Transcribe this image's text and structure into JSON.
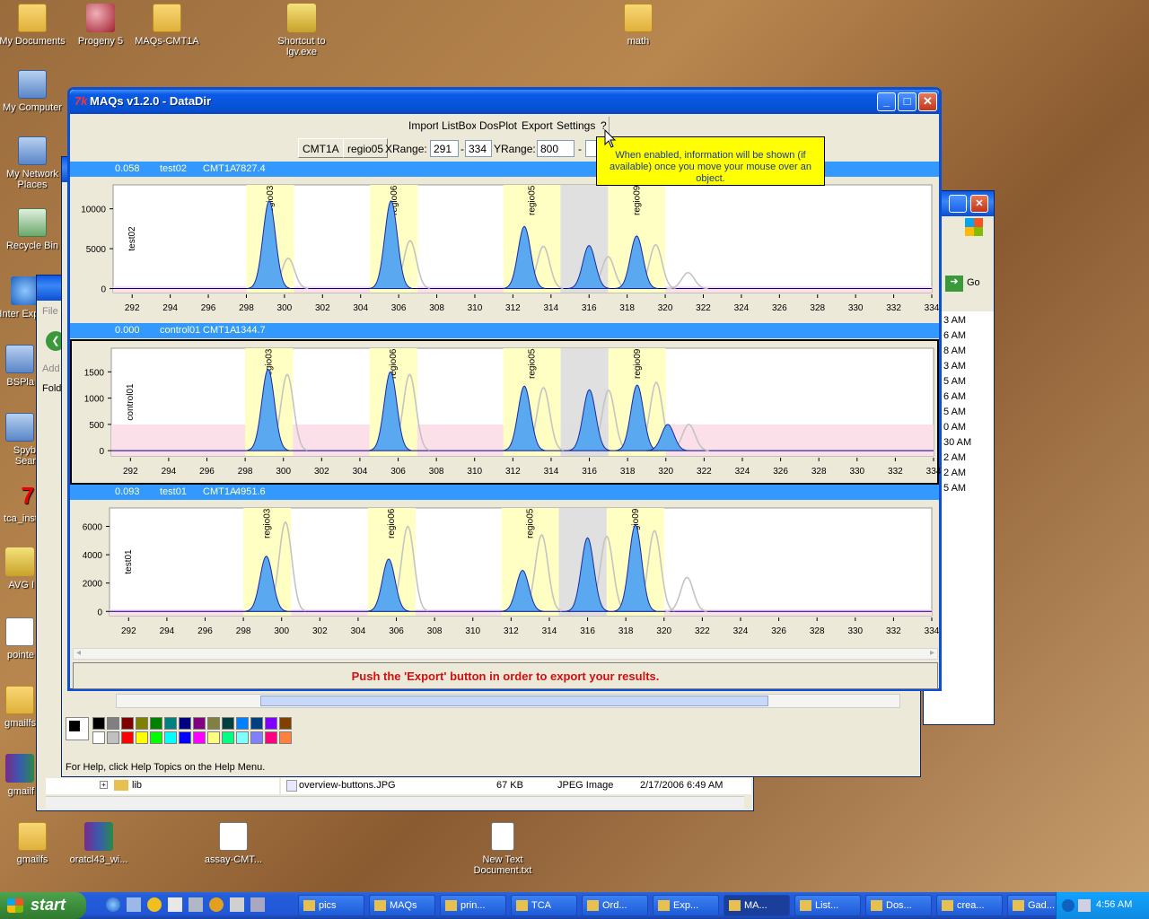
{
  "desktop_icons": [
    {
      "label": "My Documents",
      "icon": "folder-docs-icon"
    },
    {
      "label": "Progeny 5",
      "icon": "progeny-icon"
    },
    {
      "label": "MAQs-CMT1A",
      "icon": "folder-icon"
    },
    {
      "label": "Shortcut to lgv.exe",
      "icon": "lamp-icon"
    },
    {
      "label": "math",
      "icon": "folder-icon"
    },
    {
      "label": "My Computer",
      "icon": "computer-icon"
    },
    {
      "label": "My Network Places",
      "icon": "network-icon"
    },
    {
      "label": "Recycle Bin",
      "icon": "recycle-bin-icon"
    },
    {
      "label": "Inter Explo",
      "icon": "ie-icon"
    },
    {
      "label": "BSPla",
      "icon": "bsplayer-icon"
    },
    {
      "label": "Spyb Sear",
      "icon": "spybot-icon"
    },
    {
      "label": "tca_inst",
      "icon": "tk-icon"
    },
    {
      "label": "AVG I",
      "icon": "avg-icon"
    },
    {
      "label": "pointe",
      "icon": "pointer-icon"
    },
    {
      "label": "gmailfs",
      "icon": "folder-icon"
    },
    {
      "label": "gmailf",
      "icon": "rar-icon"
    },
    {
      "label": "gmailfs",
      "icon": "folder-icon"
    },
    {
      "label": "oratcl43_wi...",
      "icon": "rar-icon"
    },
    {
      "label": "assay-CMT...",
      "icon": "image-icon"
    },
    {
      "label": "New Text Document.txt",
      "icon": "text-file-icon"
    }
  ],
  "background_windows": {
    "paint": {
      "status": "For Help, click Help Topics on the Help Menu."
    },
    "explorer": {
      "menu": "File",
      "address": "Add",
      "folders": "Fold",
      "tree_item": "lib",
      "file_row": {
        "name": "overview-buttons.JPG",
        "size": "67 KB",
        "type": "JPEG Image",
        "date": "2/17/2006 6:49 AM"
      }
    },
    "right_window": {
      "go_label": "Go",
      "times": [
        "3 AM",
        "6 AM",
        "8 AM",
        "3 AM",
        "5 AM",
        "6 AM",
        "5 AM",
        "0 AM",
        "30 AM",
        "2 AM",
        "2 AM",
        "5 AM"
      ]
    }
  },
  "main_window": {
    "title": "MAQs v1.2.0 - DataDir",
    "title_icon": "tk-feather-icon",
    "toolbar": [
      "Import",
      "ListBox",
      "DosPlot",
      "Export",
      "Settings",
      "?"
    ],
    "controls": {
      "gene_button": "CMT1A",
      "region_button": "regio05",
      "xrange_label": "XRange:",
      "xrange_min": "291",
      "xrange_sep": "-",
      "xrange_max": "334",
      "yrange_label": "YRange:",
      "yrange_min": "800",
      "yrange_sep": "-"
    },
    "tooltip": "When enabled, information will be shown (if available) once you move your mouse over an object.",
    "status_message": "Push the 'Export' button in order to export your results.",
    "accent": "#3399ff"
  },
  "chart_data": [
    {
      "type": "line",
      "header": {
        "score": "0.058",
        "sample": "test02",
        "gene": "CMT1A",
        "value": "7827.4"
      },
      "ylabel": "test02",
      "xlim": [
        291,
        334
      ],
      "x_ticks": [
        292,
        294,
        296,
        298,
        300,
        302,
        304,
        306,
        308,
        310,
        312,
        314,
        316,
        318,
        320,
        322,
        324,
        326,
        328,
        330,
        332,
        334
      ],
      "y_ticks": [
        0,
        5000,
        10000
      ],
      "ylim": [
        -500,
        13000
      ],
      "regions": [
        {
          "name": "regio03",
          "x": [
            298.0,
            300.5
          ]
        },
        {
          "name": "regio06",
          "x": [
            304.5,
            307.0
          ]
        },
        {
          "name": "regio05",
          "x": [
            311.5,
            314.5
          ]
        },
        {
          "name": "",
          "x": [
            314.5,
            317.0
          ],
          "grey": true
        },
        {
          "name": "regio09",
          "x": [
            317.0,
            320.0
          ]
        }
      ],
      "peaks_sample": [
        {
          "x": 299.2,
          "y": 11000
        },
        {
          "x": 305.6,
          "y": 11000
        },
        {
          "x": 312.6,
          "y": 7800
        },
        {
          "x": 316.0,
          "y": 5400
        },
        {
          "x": 318.5,
          "y": 6600
        }
      ],
      "peaks_reference": [
        {
          "x": 300.2,
          "y": 3800
        },
        {
          "x": 306.6,
          "y": 6000
        },
        {
          "x": 313.6,
          "y": 5300
        },
        {
          "x": 317.0,
          "y": 4000
        },
        {
          "x": 319.5,
          "y": 5500
        },
        {
          "x": 321.2,
          "y": 2000
        }
      ]
    },
    {
      "type": "line",
      "header": {
        "score": "0.000",
        "sample": "control01",
        "gene": "CMT1A",
        "value": "1344.7"
      },
      "ylabel": "control01",
      "xlim": [
        291,
        334
      ],
      "x_ticks": [
        292,
        294,
        296,
        298,
        300,
        302,
        304,
        306,
        308,
        310,
        312,
        314,
        316,
        318,
        320,
        322,
        324,
        326,
        328,
        330,
        332,
        334
      ],
      "y_ticks": [
        0,
        500,
        1000,
        1500
      ],
      "ylim": [
        -100,
        1950
      ],
      "regions": [
        {
          "name": "regio03",
          "x": [
            298.0,
            300.5
          ]
        },
        {
          "name": "regio06",
          "x": [
            304.5,
            307.0
          ]
        },
        {
          "name": "regio05",
          "x": [
            311.5,
            314.5
          ]
        },
        {
          "name": "",
          "x": [
            314.5,
            317.0
          ],
          "grey": true
        },
        {
          "name": "regio09",
          "x": [
            317.0,
            320.0
          ]
        }
      ],
      "peaks_sample": [
        {
          "x": 299.2,
          "y": 1550
        },
        {
          "x": 305.6,
          "y": 1500
        },
        {
          "x": 312.6,
          "y": 1230
        },
        {
          "x": 316.0,
          "y": 1160
        },
        {
          "x": 318.5,
          "y": 1250
        },
        {
          "x": 320.1,
          "y": 500
        }
      ],
      "peaks_reference": [
        {
          "x": 300.2,
          "y": 1450
        },
        {
          "x": 306.6,
          "y": 1450
        },
        {
          "x": 313.6,
          "y": 1200
        },
        {
          "x": 317.0,
          "y": 1150
        },
        {
          "x": 319.5,
          "y": 1300
        },
        {
          "x": 321.2,
          "y": 500
        }
      ]
    },
    {
      "type": "line",
      "header": {
        "score": "0.093",
        "sample": "test01",
        "gene": "CMT1A",
        "value": "4951.6"
      },
      "ylabel": "test01",
      "xlim": [
        291,
        334
      ],
      "x_ticks": [
        292,
        294,
        296,
        298,
        300,
        302,
        304,
        306,
        308,
        310,
        312,
        314,
        316,
        318,
        320,
        322,
        324,
        326,
        328,
        330,
        332,
        334
      ],
      "y_ticks": [
        0,
        2000,
        4000,
        6000
      ],
      "ylim": [
        -300,
        7300
      ],
      "regions": [
        {
          "name": "regio03",
          "x": [
            298.0,
            300.5
          ]
        },
        {
          "name": "regio06",
          "x": [
            304.5,
            307.0
          ]
        },
        {
          "name": "regio05",
          "x": [
            311.5,
            314.5
          ]
        },
        {
          "name": "",
          "x": [
            314.5,
            317.0
          ],
          "grey": true
        },
        {
          "name": "regio09",
          "x": [
            317.0,
            320.0
          ]
        }
      ],
      "peaks_sample": [
        {
          "x": 299.2,
          "y": 3900
        },
        {
          "x": 305.6,
          "y": 3700
        },
        {
          "x": 312.6,
          "y": 2900
        },
        {
          "x": 316.0,
          "y": 5200
        },
        {
          "x": 318.5,
          "y": 6100
        }
      ],
      "peaks_reference": [
        {
          "x": 300.2,
          "y": 6300
        },
        {
          "x": 306.6,
          "y": 6000
        },
        {
          "x": 313.6,
          "y": 5400
        },
        {
          "x": 317.0,
          "y": 5300
        },
        {
          "x": 319.5,
          "y": 5700
        },
        {
          "x": 321.2,
          "y": 2400
        }
      ]
    }
  ],
  "palette": [
    "#000000",
    "#808080",
    "#800000",
    "#808000",
    "#008000",
    "#008080",
    "#000080",
    "#800080",
    "#808040",
    "#004040",
    "#0080ff",
    "#004080",
    "#8000ff",
    "#804000",
    "#ffffff",
    "#c0c0c0",
    "#ff0000",
    "#ffff00",
    "#00ff00",
    "#00ffff",
    "#0000ff",
    "#ff00ff",
    "#ffff80",
    "#00ff80",
    "#80ffff",
    "#8080ff",
    "#ff0080",
    "#ff8040"
  ],
  "taskbar": {
    "start_label": "start",
    "tasks": [
      "pics",
      "MAQs",
      "prin...",
      "TCA",
      "Ord...",
      "Exp...",
      "MA...",
      "List...",
      "Dos...",
      "crea...",
      "Gad..."
    ],
    "active_task": 6,
    "clock": "4:56 AM"
  }
}
